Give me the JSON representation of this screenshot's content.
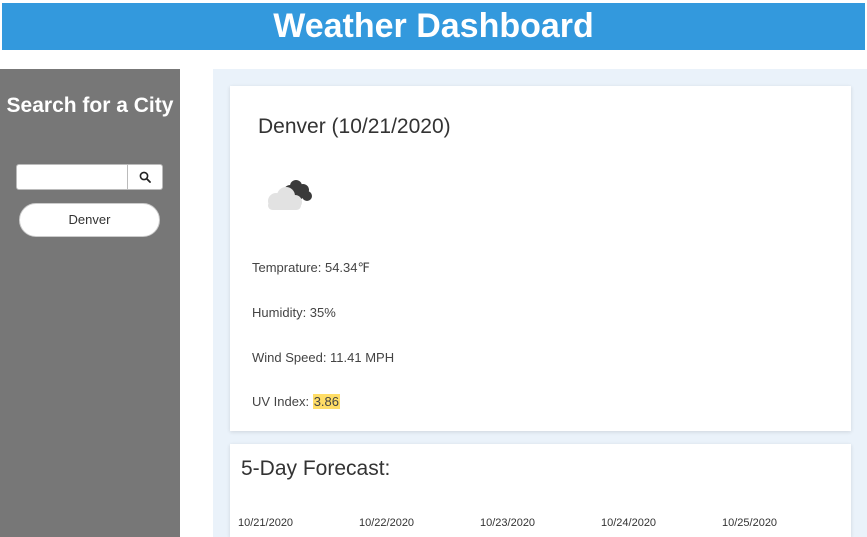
{
  "header": {
    "title": "Weather Dashboard"
  },
  "sidebar": {
    "title": "Search for a City",
    "search": {
      "value": "",
      "placeholder": ""
    },
    "search_icon": "search-icon",
    "history": [
      "Denver"
    ]
  },
  "current": {
    "title": "Denver (10/21/2020)",
    "icon": "cloudy-icon",
    "temperature_label": "Temprature: 54.34℉",
    "humidity_label": "Humidity: 35%",
    "wind_label": "Wind Speed: 11.41 MPH",
    "uv_prefix": "UV Index: ",
    "uv_value": "3.86",
    "uv_color": "#ffdd66"
  },
  "forecast": {
    "title": "5-Day Forecast:",
    "days": [
      {
        "date": "10/21/2020"
      },
      {
        "date": "10/22/2020"
      },
      {
        "date": "10/23/2020"
      },
      {
        "date": "10/24/2020"
      },
      {
        "date": "10/25/2020"
      }
    ]
  },
  "colors": {
    "header_bg": "#3399dd",
    "sidebar_bg": "#777777",
    "main_bg": "#eaf2fa"
  }
}
